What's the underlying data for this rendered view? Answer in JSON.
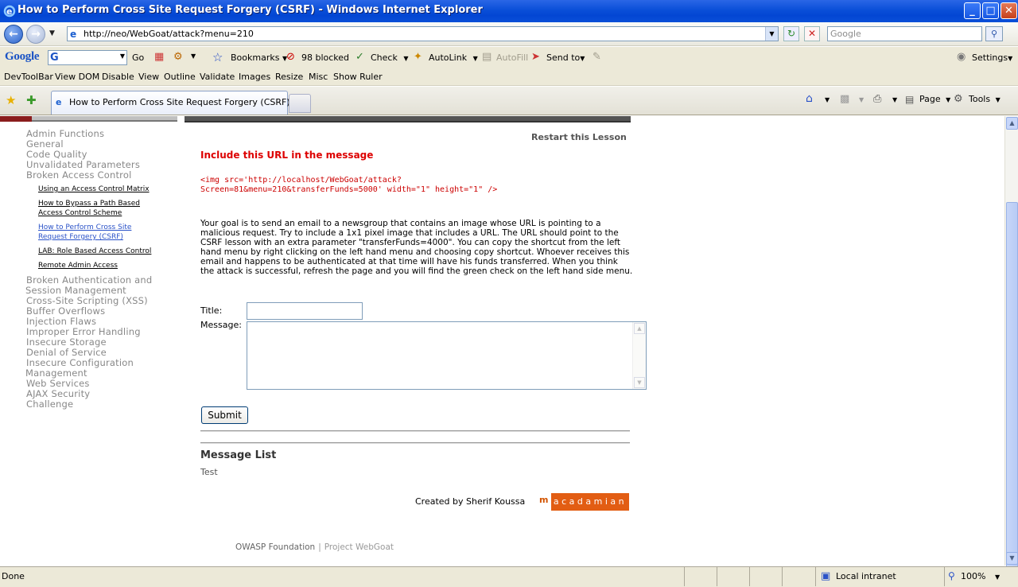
{
  "window": {
    "title": "How to Perform Cross Site Request Forgery (CSRF) - Windows Internet Explorer",
    "controls": {
      "minimize": "_",
      "maximize": "□",
      "close": "✕"
    }
  },
  "address": {
    "url": "http://neo/WebGoat/attack?menu=210",
    "search_placeholder": "Google"
  },
  "google_toolbar": {
    "logo": "Google",
    "go": "Go",
    "bookmarks": "Bookmarks",
    "blocked": "98 blocked",
    "check": "Check",
    "autolink": "AutoLink",
    "autofill": "AutoFill",
    "send_to": "Send to",
    "settings": "Settings"
  },
  "devtoolbar": [
    "DevToolBar",
    "View DOM",
    "Disable",
    "View",
    "Outline",
    "Validate",
    "Images",
    "Resize",
    "Misc",
    "Show Ruler"
  ],
  "tab": {
    "label": "How to Perform Cross Site Request Forgery (CSRF)"
  },
  "tab_tools": {
    "page": "Page",
    "tools": "Tools"
  },
  "menu": {
    "categories_top": [
      "Admin Functions",
      "General",
      "Code Quality",
      "Unvalidated Parameters",
      "Broken Access Control"
    ],
    "sub_items": [
      {
        "lines": [
          "Using an Access Control Matrix"
        ],
        "active": false
      },
      {
        "lines": [
          "How to Bypass a Path Based",
          "Access Control Scheme"
        ],
        "active": false
      },
      {
        "lines": [
          "How to Perform Cross Site",
          "Request Forgery (CSRF)"
        ],
        "active": true
      },
      {
        "lines": [
          "LAB: Role Based Access Control"
        ],
        "active": false
      },
      {
        "lines": [
          "Remote Admin Access"
        ],
        "active": false
      }
    ],
    "categories_bottom": [
      [
        "Broken Authentication and",
        "Session Management"
      ],
      [
        "Cross-Site Scripting (XSS)"
      ],
      [
        "Buffer Overflows"
      ],
      [
        "Injection Flaws"
      ],
      [
        "Improper Error Handling"
      ],
      [
        "Insecure Storage"
      ],
      [
        "Denial of Service"
      ],
      [
        "Insecure Configuration",
        "Management"
      ],
      [
        "Web Services"
      ],
      [
        "AJAX Security"
      ],
      [
        "Challenge"
      ]
    ]
  },
  "lesson": {
    "restart": "Restart this Lesson",
    "include_heading": "Include this URL in the message",
    "code_line1": "<img src='http://localhost/WebGoat/attack?",
    "code_line2": "Screen=81&menu=210&transferFunds=5000' width=\"1\" height=\"1\" />",
    "goal": "Your goal is to send an email to a newsgroup that contains an image whose URL is pointing to a malicious request. Try to include a 1x1 pixel image that includes a URL. The URL should point to the CSRF lesson with an extra parameter \"transferFunds=4000\". You can copy the shortcut from the left hand menu by right clicking on the left hand menu and choosing copy shortcut. Whoever receives this email and happens to be authenticated at that time will have his funds transferred. When you think the attack is successful, refresh the page and you will find the green check on the left hand side menu.",
    "title_label": "Title:",
    "message_label": "Message:",
    "title_value": "",
    "message_value": "",
    "submit": "Submit",
    "message_list_heading": "Message List",
    "messages": [
      "Test"
    ],
    "created_by": "Created by Sherif Koussa",
    "logo_prefix": "m",
    "logo_text": "acadamian"
  },
  "footer": {
    "owasp": "OWASP Foundation",
    "separator": "|",
    "project": "Project WebGoat"
  },
  "status": {
    "text": "Done",
    "zone": "Local intranet",
    "zoom": "100%"
  }
}
